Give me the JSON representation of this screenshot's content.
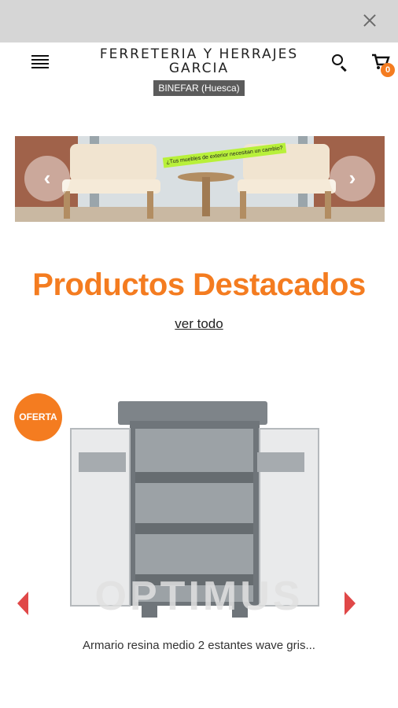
{
  "colors": {
    "accent": "#f47c20",
    "topbar": "#d6d6d6",
    "location_bg": "#5b5b5b"
  },
  "icons": {
    "close": "close-icon",
    "menu": "hamburger-menu-icon",
    "search": "search-icon",
    "cart": "shopping-cart-icon",
    "prev": "chevron-left-icon",
    "next": "chevron-right-icon"
  },
  "header": {
    "brand_name": "FERRETERIA Y HERRAJES GARCIA",
    "location": "BINEFAR (Huesca)",
    "cart_count": "0"
  },
  "banner": {
    "tag": "¿Tus muebles de exterior necesitan un cambio?",
    "prev_glyph": "‹",
    "next_glyph": "›"
  },
  "featured": {
    "title": "Productos Destacados",
    "view_all": "ver todo"
  },
  "product": {
    "badge": "OFERTA",
    "watermark": "OPTIMUS",
    "name": "Armario resina medio 2 estantes wave gris..."
  }
}
